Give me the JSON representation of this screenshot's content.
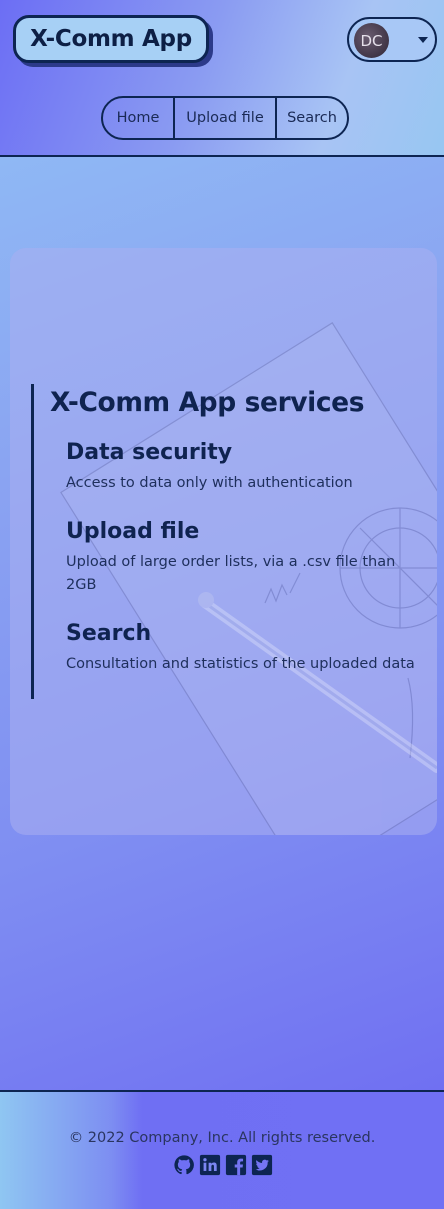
{
  "header": {
    "logo": "X-Comm App",
    "user": {
      "initials": "DC"
    },
    "nav": [
      {
        "label": "Home"
      },
      {
        "label": "Upload file"
      },
      {
        "label": "Search"
      }
    ]
  },
  "main": {
    "services_title": "X-Comm App services",
    "services": [
      {
        "title": "Data security",
        "description": "Access to data only with authentication"
      },
      {
        "title": "Upload file",
        "description": "Upload of large order lists, via a .csv file than 2GB"
      },
      {
        "title": "Search",
        "description": "Consultation and statistics of the uploaded data"
      }
    ]
  },
  "footer": {
    "copyright": "© 2022 Company, Inc. All rights reserved.",
    "socials": [
      "github-icon",
      "linkedin-icon",
      "facebook-icon",
      "twitter-icon"
    ]
  },
  "colors": {
    "navy": "#0d2552",
    "gradient_start": "#6c6ef4",
    "gradient_end": "#97c6f2"
  }
}
